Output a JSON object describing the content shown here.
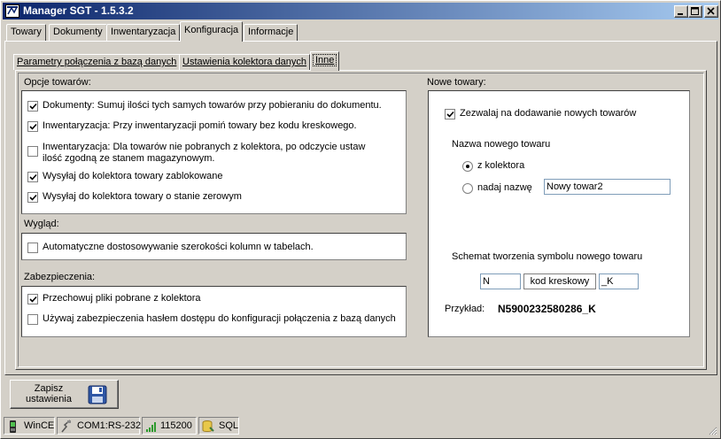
{
  "window": {
    "title": "Manager SGT - 1.5.3.2"
  },
  "tabs": [
    {
      "label": "Towary"
    },
    {
      "label": "Dokumenty"
    },
    {
      "label": "Inwentaryzacja"
    },
    {
      "label": "Konfiguracja"
    },
    {
      "label": "Informacje"
    }
  ],
  "subtabs": [
    {
      "label": "Parametry połączenia z bazą danych"
    },
    {
      "label": "Ustawienia kolektora danych"
    },
    {
      "label": "Inne"
    }
  ],
  "opcje": {
    "label": "Opcje towarów:",
    "items": [
      {
        "text": "Dokumenty: Sumuj ilości tych samych towarów przy pobieraniu do dokumentu.",
        "checked": true
      },
      {
        "text": "Inwentaryzacja: Przy inwentaryzacji pomiń towary bez kodu kreskowego.",
        "checked": true
      },
      {
        "text": "Inwentaryzacja: Dla towarów nie pobranych z kolektora, po odczycie ustaw",
        "text2": "ilość zgodną ze stanem magazynowym.",
        "checked": false
      },
      {
        "text": "Wysyłaj do kolektora towary zablokowane",
        "checked": true
      },
      {
        "text": "Wysyłaj do kolektora towary o stanie zerowym",
        "checked": true
      }
    ]
  },
  "wyglad": {
    "label": "Wygląd:",
    "items": [
      {
        "text": "Automatyczne dostosowywanie szerokości kolumn w tabelach.",
        "checked": false
      }
    ]
  },
  "zabezpieczenia": {
    "label": "Zabezpieczenia:",
    "items": [
      {
        "text": "Przechowuj pliki pobrane z kolektora",
        "checked": true
      },
      {
        "text": "Używaj zabezpieczenia hasłem dostępu do konfiguracji połączenia z bazą danych",
        "checked": false
      }
    ]
  },
  "nowe": {
    "label": "Nowe towary:",
    "allow": {
      "text": "Zezwalaj na dodawanie nowych towarów",
      "checked": true
    },
    "name_label": "Nazwa nowego towaru",
    "radio_kolektor": {
      "text": "z kolektora",
      "selected": true
    },
    "radio_nadaj": {
      "text": "nadaj nazwę",
      "selected": false
    },
    "name_value": "Nowy towar2",
    "schema_label": "Schemat tworzenia symbolu nowego towaru",
    "prefix_value": "N",
    "middle_label": "kod kreskowy",
    "suffix_value": "_K",
    "example_label": "Przykład:",
    "example_value": "N5900232580286_K"
  },
  "save_button": {
    "line1": "Zapisz",
    "line2": "ustawienia"
  },
  "status": {
    "device": "WinCE",
    "port": "COM1:RS-232",
    "baud": "115200",
    "db": "SQL"
  }
}
